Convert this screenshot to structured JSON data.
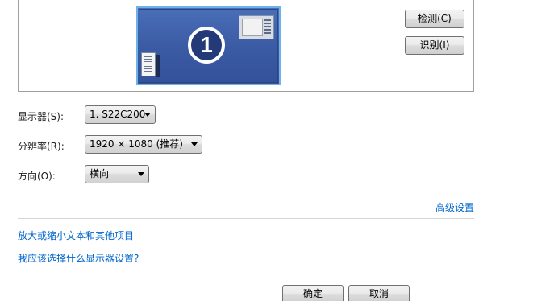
{
  "preview": {
    "monitor_number": "1"
  },
  "buttons": {
    "detect": "检测(C)",
    "identify": "识别(I)",
    "ok": "确定",
    "cancel": "取消"
  },
  "form": {
    "display_label": "显示器(S):",
    "display_value": "1. S22C200",
    "resolution_label": "分辨率(R):",
    "resolution_value": "1920 × 1080 (推荐)",
    "orientation_label": "方向(O):",
    "orientation_value": "横向"
  },
  "links": {
    "advanced": "高级设置",
    "text_size": "放大或缩小文本和其他项目",
    "which_settings": "我应该选择什么显示器设置?"
  }
}
